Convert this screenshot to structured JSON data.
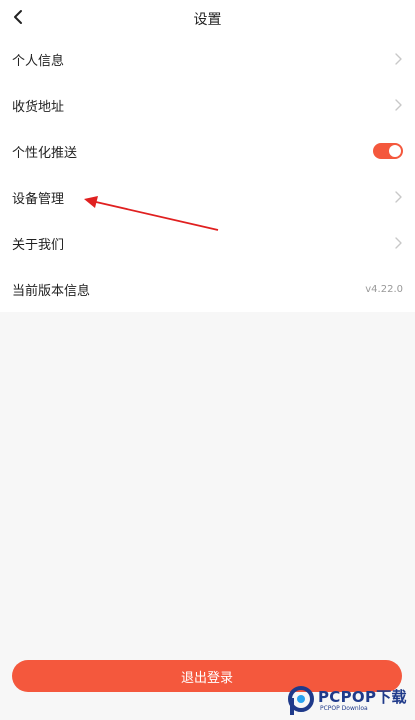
{
  "header": {
    "title": "设置",
    "back_icon": "chevron-left-icon"
  },
  "settings": {
    "personal_info": "个人信息",
    "shipping_address": "收货地址",
    "personalized_push": {
      "label": "个性化推送",
      "enabled": true
    },
    "device_management": "设备管理",
    "about_us": "关于我们",
    "current_version": {
      "label": "当前版本信息",
      "value": "v4.22.0"
    }
  },
  "logout_button": "退出登录",
  "colors": {
    "accent": "#f4583d",
    "arrow": "#e02020"
  },
  "watermark": {
    "brand": "PCPOP下载",
    "subtitle": "PCPOP Downloa"
  }
}
